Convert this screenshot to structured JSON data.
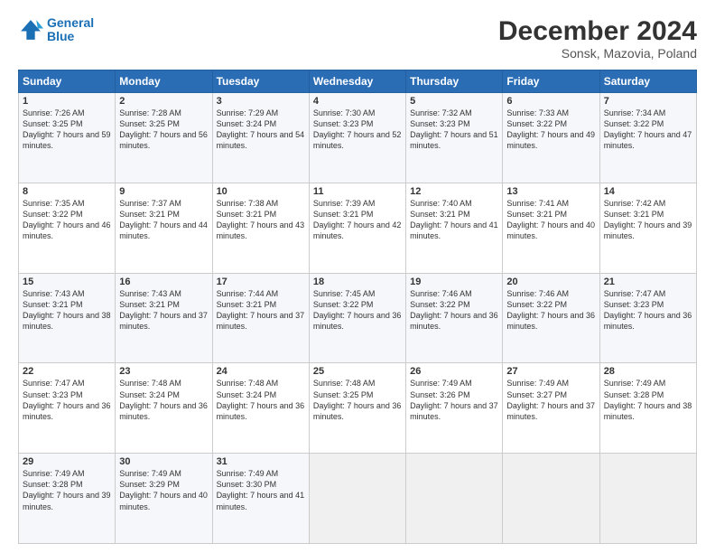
{
  "logo": {
    "line1": "General",
    "line2": "Blue"
  },
  "title": "December 2024",
  "location": "Sonsk, Mazovia, Poland",
  "days_of_week": [
    "Sunday",
    "Monday",
    "Tuesday",
    "Wednesday",
    "Thursday",
    "Friday",
    "Saturday"
  ],
  "weeks": [
    [
      {
        "day": "1",
        "sunrise": "Sunrise: 7:26 AM",
        "sunset": "Sunset: 3:25 PM",
        "daylight": "Daylight: 7 hours and 59 minutes."
      },
      {
        "day": "2",
        "sunrise": "Sunrise: 7:28 AM",
        "sunset": "Sunset: 3:25 PM",
        "daylight": "Daylight: 7 hours and 56 minutes."
      },
      {
        "day": "3",
        "sunrise": "Sunrise: 7:29 AM",
        "sunset": "Sunset: 3:24 PM",
        "daylight": "Daylight: 7 hours and 54 minutes."
      },
      {
        "day": "4",
        "sunrise": "Sunrise: 7:30 AM",
        "sunset": "Sunset: 3:23 PM",
        "daylight": "Daylight: 7 hours and 52 minutes."
      },
      {
        "day": "5",
        "sunrise": "Sunrise: 7:32 AM",
        "sunset": "Sunset: 3:23 PM",
        "daylight": "Daylight: 7 hours and 51 minutes."
      },
      {
        "day": "6",
        "sunrise": "Sunrise: 7:33 AM",
        "sunset": "Sunset: 3:22 PM",
        "daylight": "Daylight: 7 hours and 49 minutes."
      },
      {
        "day": "7",
        "sunrise": "Sunrise: 7:34 AM",
        "sunset": "Sunset: 3:22 PM",
        "daylight": "Daylight: 7 hours and 47 minutes."
      }
    ],
    [
      {
        "day": "8",
        "sunrise": "Sunrise: 7:35 AM",
        "sunset": "Sunset: 3:22 PM",
        "daylight": "Daylight: 7 hours and 46 minutes."
      },
      {
        "day": "9",
        "sunrise": "Sunrise: 7:37 AM",
        "sunset": "Sunset: 3:21 PM",
        "daylight": "Daylight: 7 hours and 44 minutes."
      },
      {
        "day": "10",
        "sunrise": "Sunrise: 7:38 AM",
        "sunset": "Sunset: 3:21 PM",
        "daylight": "Daylight: 7 hours and 43 minutes."
      },
      {
        "day": "11",
        "sunrise": "Sunrise: 7:39 AM",
        "sunset": "Sunset: 3:21 PM",
        "daylight": "Daylight: 7 hours and 42 minutes."
      },
      {
        "day": "12",
        "sunrise": "Sunrise: 7:40 AM",
        "sunset": "Sunset: 3:21 PM",
        "daylight": "Daylight: 7 hours and 41 minutes."
      },
      {
        "day": "13",
        "sunrise": "Sunrise: 7:41 AM",
        "sunset": "Sunset: 3:21 PM",
        "daylight": "Daylight: 7 hours and 40 minutes."
      },
      {
        "day": "14",
        "sunrise": "Sunrise: 7:42 AM",
        "sunset": "Sunset: 3:21 PM",
        "daylight": "Daylight: 7 hours and 39 minutes."
      }
    ],
    [
      {
        "day": "15",
        "sunrise": "Sunrise: 7:43 AM",
        "sunset": "Sunset: 3:21 PM",
        "daylight": "Daylight: 7 hours and 38 minutes."
      },
      {
        "day": "16",
        "sunrise": "Sunrise: 7:43 AM",
        "sunset": "Sunset: 3:21 PM",
        "daylight": "Daylight: 7 hours and 37 minutes."
      },
      {
        "day": "17",
        "sunrise": "Sunrise: 7:44 AM",
        "sunset": "Sunset: 3:21 PM",
        "daylight": "Daylight: 7 hours and 37 minutes."
      },
      {
        "day": "18",
        "sunrise": "Sunrise: 7:45 AM",
        "sunset": "Sunset: 3:22 PM",
        "daylight": "Daylight: 7 hours and 36 minutes."
      },
      {
        "day": "19",
        "sunrise": "Sunrise: 7:46 AM",
        "sunset": "Sunset: 3:22 PM",
        "daylight": "Daylight: 7 hours and 36 minutes."
      },
      {
        "day": "20",
        "sunrise": "Sunrise: 7:46 AM",
        "sunset": "Sunset: 3:22 PM",
        "daylight": "Daylight: 7 hours and 36 minutes."
      },
      {
        "day": "21",
        "sunrise": "Sunrise: 7:47 AM",
        "sunset": "Sunset: 3:23 PM",
        "daylight": "Daylight: 7 hours and 36 minutes."
      }
    ],
    [
      {
        "day": "22",
        "sunrise": "Sunrise: 7:47 AM",
        "sunset": "Sunset: 3:23 PM",
        "daylight": "Daylight: 7 hours and 36 minutes."
      },
      {
        "day": "23",
        "sunrise": "Sunrise: 7:48 AM",
        "sunset": "Sunset: 3:24 PM",
        "daylight": "Daylight: 7 hours and 36 minutes."
      },
      {
        "day": "24",
        "sunrise": "Sunrise: 7:48 AM",
        "sunset": "Sunset: 3:24 PM",
        "daylight": "Daylight: 7 hours and 36 minutes."
      },
      {
        "day": "25",
        "sunrise": "Sunrise: 7:48 AM",
        "sunset": "Sunset: 3:25 PM",
        "daylight": "Daylight: 7 hours and 36 minutes."
      },
      {
        "day": "26",
        "sunrise": "Sunrise: 7:49 AM",
        "sunset": "Sunset: 3:26 PM",
        "daylight": "Daylight: 7 hours and 37 minutes."
      },
      {
        "day": "27",
        "sunrise": "Sunrise: 7:49 AM",
        "sunset": "Sunset: 3:27 PM",
        "daylight": "Daylight: 7 hours and 37 minutes."
      },
      {
        "day": "28",
        "sunrise": "Sunrise: 7:49 AM",
        "sunset": "Sunset: 3:28 PM",
        "daylight": "Daylight: 7 hours and 38 minutes."
      }
    ],
    [
      {
        "day": "29",
        "sunrise": "Sunrise: 7:49 AM",
        "sunset": "Sunset: 3:28 PM",
        "daylight": "Daylight: 7 hours and 39 minutes."
      },
      {
        "day": "30",
        "sunrise": "Sunrise: 7:49 AM",
        "sunset": "Sunset: 3:29 PM",
        "daylight": "Daylight: 7 hours and 40 minutes."
      },
      {
        "day": "31",
        "sunrise": "Sunrise: 7:49 AM",
        "sunset": "Sunset: 3:30 PM",
        "daylight": "Daylight: 7 hours and 41 minutes."
      },
      null,
      null,
      null,
      null
    ]
  ]
}
